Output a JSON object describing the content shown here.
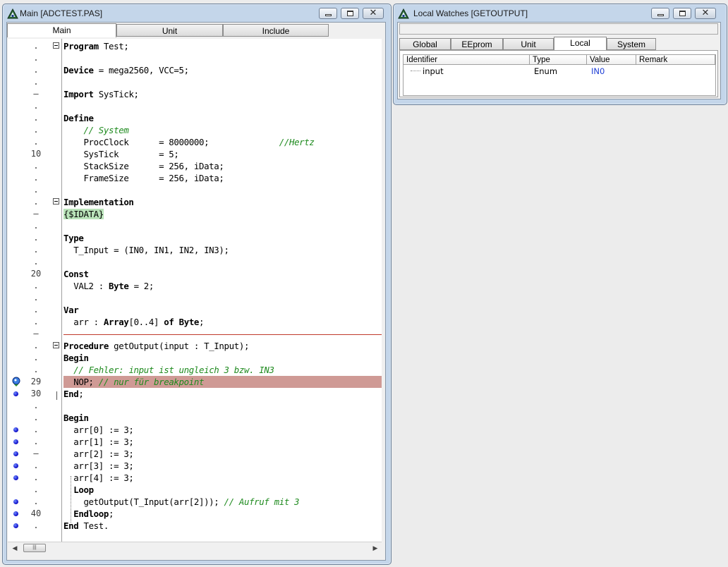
{
  "main_window": {
    "title": "Main [ADCTEST.PAS]",
    "tabs": [
      "Main",
      "Unit",
      "Include"
    ],
    "code_lines": [
      {
        "ln": ".",
        "fold": true,
        "html": "<span class=\"kw\">Program</span> Test;"
      },
      {
        "ln": ".",
        "html": ""
      },
      {
        "ln": ".",
        "html": "<span class=\"kw\">Device</span> = mega2560, VCC=5;"
      },
      {
        "ln": ".",
        "html": ""
      },
      {
        "ln": "–",
        "html": "<span class=\"kw\">Import</span> SysTick;"
      },
      {
        "ln": ".",
        "html": ""
      },
      {
        "ln": ".",
        "html": "<span class=\"kw\">Define</span>"
      },
      {
        "ln": ".",
        "html": "    <span class=\"cm\">// System</span>"
      },
      {
        "ln": ".",
        "html": "    ProcClock      = 8000000;              <span class=\"cm\">//Hertz</span>"
      },
      {
        "ln": "10",
        "html": "    SysTick        = 5;"
      },
      {
        "ln": ".",
        "html": "    StackSize      = 256, iData;"
      },
      {
        "ln": ".",
        "html": "    FrameSize      = 256, iData;"
      },
      {
        "ln": ".",
        "html": ""
      },
      {
        "ln": ".",
        "fold": true,
        "html": "<span class=\"kw\">Implementation</span>"
      },
      {
        "ln": "–",
        "html": "<span class=\"idata\">{$IDATA}</span>"
      },
      {
        "ln": ".",
        "html": ""
      },
      {
        "ln": ".",
        "html": "<span class=\"kw\">Type</span>"
      },
      {
        "ln": ".",
        "html": "  T_Input = (IN0, IN1, IN2, IN3);"
      },
      {
        "ln": ".",
        "html": ""
      },
      {
        "ln": "20",
        "html": "<span class=\"kw\">Const</span>"
      },
      {
        "ln": ".",
        "html": "  VAL2 : <span class=\"kw\">Byte</span> = 2;"
      },
      {
        "ln": ".",
        "html": ""
      },
      {
        "ln": ".",
        "html": "<span class=\"kw\">Var</span>"
      },
      {
        "ln": ".",
        "html": "  arr : <span class=\"kw\">Array</span>[0..4] <span class=\"kw\">of</span> <span class=\"kw\">Byte</span>;"
      },
      {
        "ln": "–",
        "html": "",
        "sep": true
      },
      {
        "ln": ".",
        "fold": true,
        "html": "<span class=\"kw\">Procedure</span> getOutput(input : T_Input);"
      },
      {
        "ln": ".",
        "html": "<span class=\"kw\">Begin</span>"
      },
      {
        "ln": ".",
        "html": "  <span class=\"cm\">// Fehler: input ist ungleich 3 bzw. IN3</span>"
      },
      {
        "ln": "29",
        "bp": "current",
        "highlight": true,
        "html": "  NOP; <span class=\"cm\">// nur für breakpoint</span>"
      },
      {
        "ln": "30",
        "bp": "dot",
        "html": "<span class=\"kw\">End</span>;"
      },
      {
        "ln": ".",
        "html": ""
      },
      {
        "ln": ".",
        "html": "<span class=\"kw\">Begin</span>"
      },
      {
        "ln": ".",
        "bp": "dot",
        "html": "  arr[0] := 3;"
      },
      {
        "ln": ".",
        "bp": "dot",
        "html": "  arr[1] := 3;"
      },
      {
        "ln": "–",
        "bp": "dot",
        "html": "  arr[2] := 3;"
      },
      {
        "ln": ".",
        "bp": "dot",
        "html": "  arr[3] := 3;"
      },
      {
        "ln": ".",
        "bp": "dot",
        "html": "  arr[4] := 3;"
      },
      {
        "ln": ".",
        "html": "  <span class=\"kw\">Loop</span>"
      },
      {
        "ln": ".",
        "bp": "dot",
        "html": "    getOutput(T_Input(arr[2])); <span class=\"cm\">// Aufruf mit 3</span>"
      },
      {
        "ln": "40",
        "bp": "dot",
        "html": "  <span class=\"kw\">Endloop</span>;"
      },
      {
        "ln": ".",
        "bp": "dot",
        "html": "<span class=\"kw\">End</span> Test."
      }
    ]
  },
  "watches_window": {
    "title": "Local Watches [GETOUTPUT]",
    "tabs": [
      "Global",
      "EEprom",
      "Unit",
      "Local",
      "System"
    ],
    "columns": [
      "Identifier",
      "Type",
      "Value",
      "Remark"
    ],
    "rows": [
      {
        "identifier": "input",
        "type": "Enum",
        "value": "IN0",
        "remark": ""
      }
    ]
  },
  "colors": {
    "value_text": "#1f3fd6",
    "comment": "#1e8a1e",
    "highlight_line": "#cf9a95",
    "title_bar": "#c4d6ea"
  },
  "icons": [
    "app-logo-icon",
    "minimize-icon",
    "maximize-icon",
    "close-icon",
    "breakpoint-icon",
    "current-line-icon",
    "fold-toggle-icon"
  ]
}
